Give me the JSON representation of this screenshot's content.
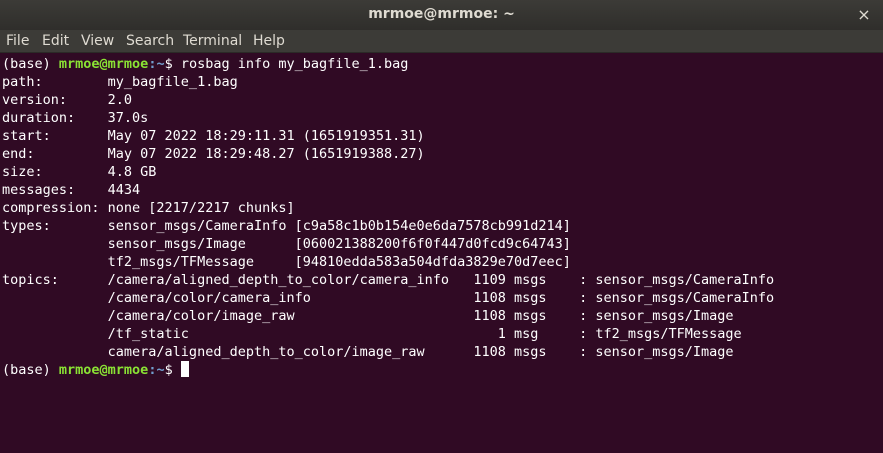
{
  "window": {
    "title": "mrmoe@mrmoe: ~",
    "close_glyph": "×"
  },
  "menu": {
    "file": "File",
    "edit": "Edit",
    "view": "View",
    "search": "Search",
    "terminal": "Terminal",
    "help": "Help"
  },
  "prompt": {
    "env": "(base) ",
    "user_host": "mrmoe@mrmoe",
    "path": ":~",
    "symbol": "$ "
  },
  "command": "rosbag info my_bagfile_1.bag",
  "output": [
    "path:        my_bagfile_1.bag",
    "version:     2.0",
    "duration:    37.0s",
    "start:       May 07 2022 18:29:11.31 (1651919351.31)",
    "end:         May 07 2022 18:29:48.27 (1651919388.27)",
    "size:        4.8 GB",
    "messages:    4434",
    "compression: none [2217/2217 chunks]",
    "types:       sensor_msgs/CameraInfo [c9a58c1b0b154e0e6da7578cb991d214]",
    "             sensor_msgs/Image      [060021388200f6f0f447d0fcd9c64743]",
    "             tf2_msgs/TFMessage     [94810edda583a504dfda3829e70d7eec]",
    "topics:      /camera/aligned_depth_to_color/camera_info   1109 msgs    : sensor_msgs/CameraInfo",
    "             /camera/color/camera_info                    1108 msgs    : sensor_msgs/CameraInfo",
    "             /camera/color/image_raw                      1108 msgs    : sensor_msgs/Image",
    "             /tf_static                                      1 msg     : tf2_msgs/TFMessage",
    "             camera/aligned_depth_to_color/image_raw      1108 msgs    : sensor_msgs/Image"
  ],
  "colors": {
    "background": "#300a24",
    "prompt_user": "#8ae234",
    "prompt_path": "#729fcf",
    "text": "#ffffff"
  }
}
